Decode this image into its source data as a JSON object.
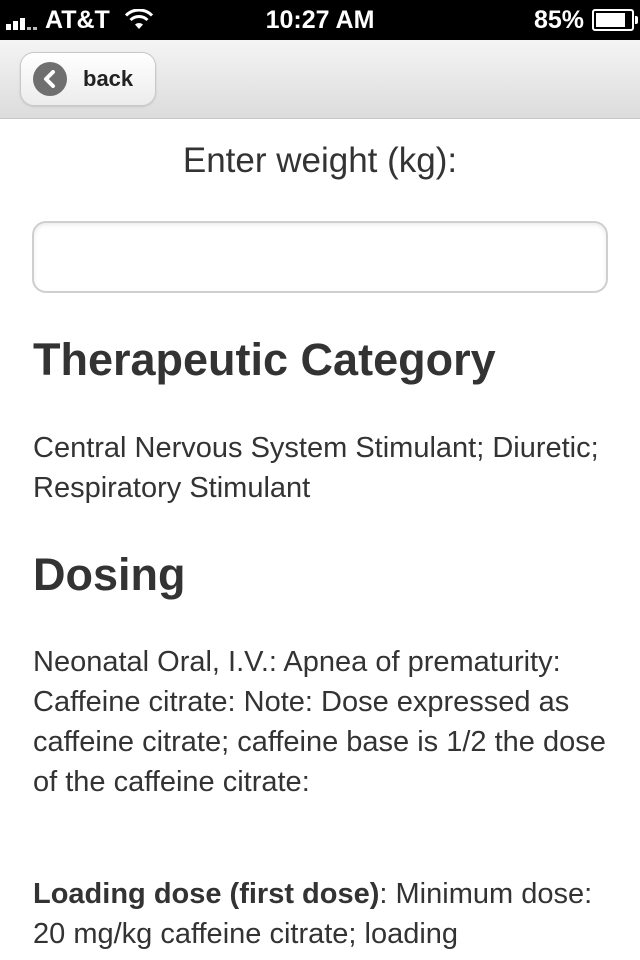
{
  "status_bar": {
    "carrier": "AT&T",
    "time": "10:27 AM",
    "battery_percent": "85%"
  },
  "header": {
    "back_label": "back"
  },
  "weight": {
    "label": "Enter weight (kg):",
    "value": "",
    "placeholder": ""
  },
  "sections": {
    "therapeutic_category": {
      "heading": "Therapeutic Category",
      "text": "Central Nervous System Stimulant; Diuretic; Respiratory Stimulant"
    },
    "dosing": {
      "heading": "Dosing",
      "text": "Neonatal Oral, I.V.: Apnea of prematurity: Caffeine citrate: Note: Dose expressed as caffeine citrate; caffeine base is 1/2 the dose of the caffeine citrate:",
      "loading_label": "Loading dose (first dose)",
      "loading_text": ": Minimum dose: 20 mg/kg caffeine citrate; loading"
    }
  }
}
